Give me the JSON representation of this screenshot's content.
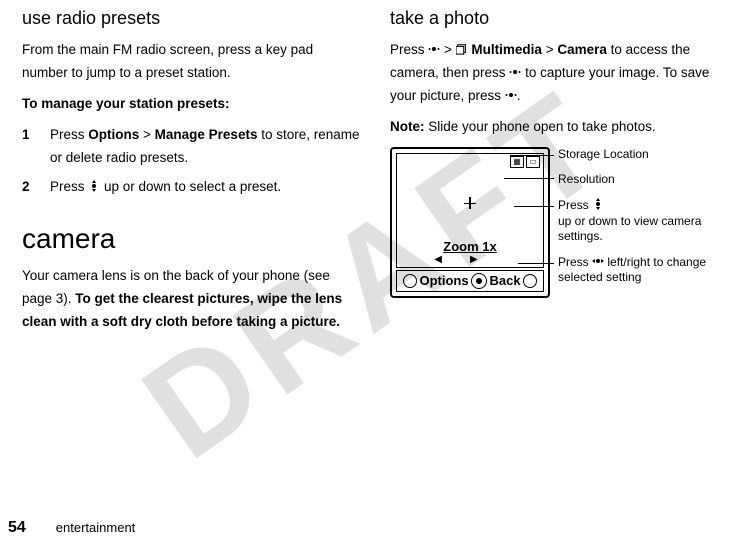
{
  "watermark": "DRAFT",
  "left": {
    "h_preset": "use radio presets",
    "p1": "From the main FM radio screen, press a key pad number to jump to a preset station.",
    "p2_label": "To manage your station presets:",
    "step1_num": "1",
    "step1_a": "Press ",
    "step1_options": "Options",
    "step1_gt": " > ",
    "step1_manage": "Manage Presets",
    "step1_b": " to store, rename or delete radio presets.",
    "step2_num": "2",
    "step2_a": "Press ",
    "step2_b": " up or down to select a preset.",
    "h_camera": "camera",
    "p3": "Your camera lens is on the back of your phone (see page 3). ",
    "p3_bold": "To get the clearest pictures, wipe the lens clean with a soft dry cloth before taking a picture."
  },
  "right": {
    "h_photo": "take a photo",
    "p1_a": "Press ",
    "p1_gt1": " > ",
    "p1_multimedia": "Multimedia",
    "p1_gt2": " > ",
    "p1_camera": "Camera",
    "p1_b": " to access the camera, then press ",
    "p1_c": " to capture your image. To save your picture, press ",
    "p1_d": ".",
    "note_label": "Note:",
    "note_text": " Slide your phone open to take photos.",
    "fig": {
      "zoom": "Zoom 1x",
      "opt": "Options",
      "back": "Back",
      "co1": "Storage Location",
      "co2": "Resolution",
      "co3_a": "Press ",
      "co3_b": " up or down to view camera settings.",
      "co4_a": "Press ",
      "co4_b": " left/right to change selected setting"
    }
  },
  "footer": {
    "page": "54",
    "section": "entertainment"
  }
}
